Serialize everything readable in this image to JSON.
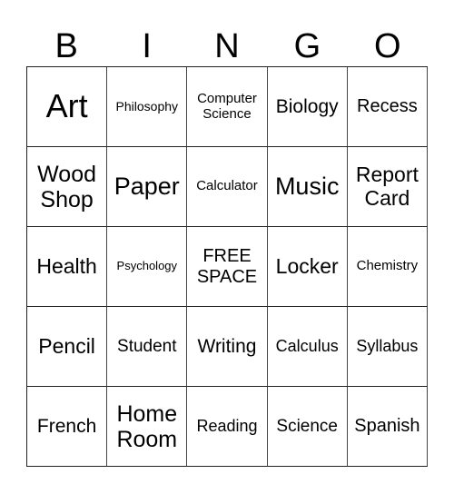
{
  "header": [
    "B",
    "I",
    "N",
    "G",
    "O"
  ],
  "cells": [
    [
      "Art",
      "Philosophy",
      "Computer\nScience",
      "Biology",
      "Recess"
    ],
    [
      "Wood\nShop",
      "Paper",
      "Calculator",
      "Music",
      "Report\nCard"
    ],
    [
      "Health",
      "Psychology",
      "FREE\nSPACE",
      "Locker",
      "Chemistry"
    ],
    [
      "Pencil",
      "Student",
      "Writing",
      "Calculus",
      "Syllabus"
    ],
    [
      "French",
      "Home\nRoom",
      "Reading",
      "Science",
      "Spanish"
    ]
  ]
}
